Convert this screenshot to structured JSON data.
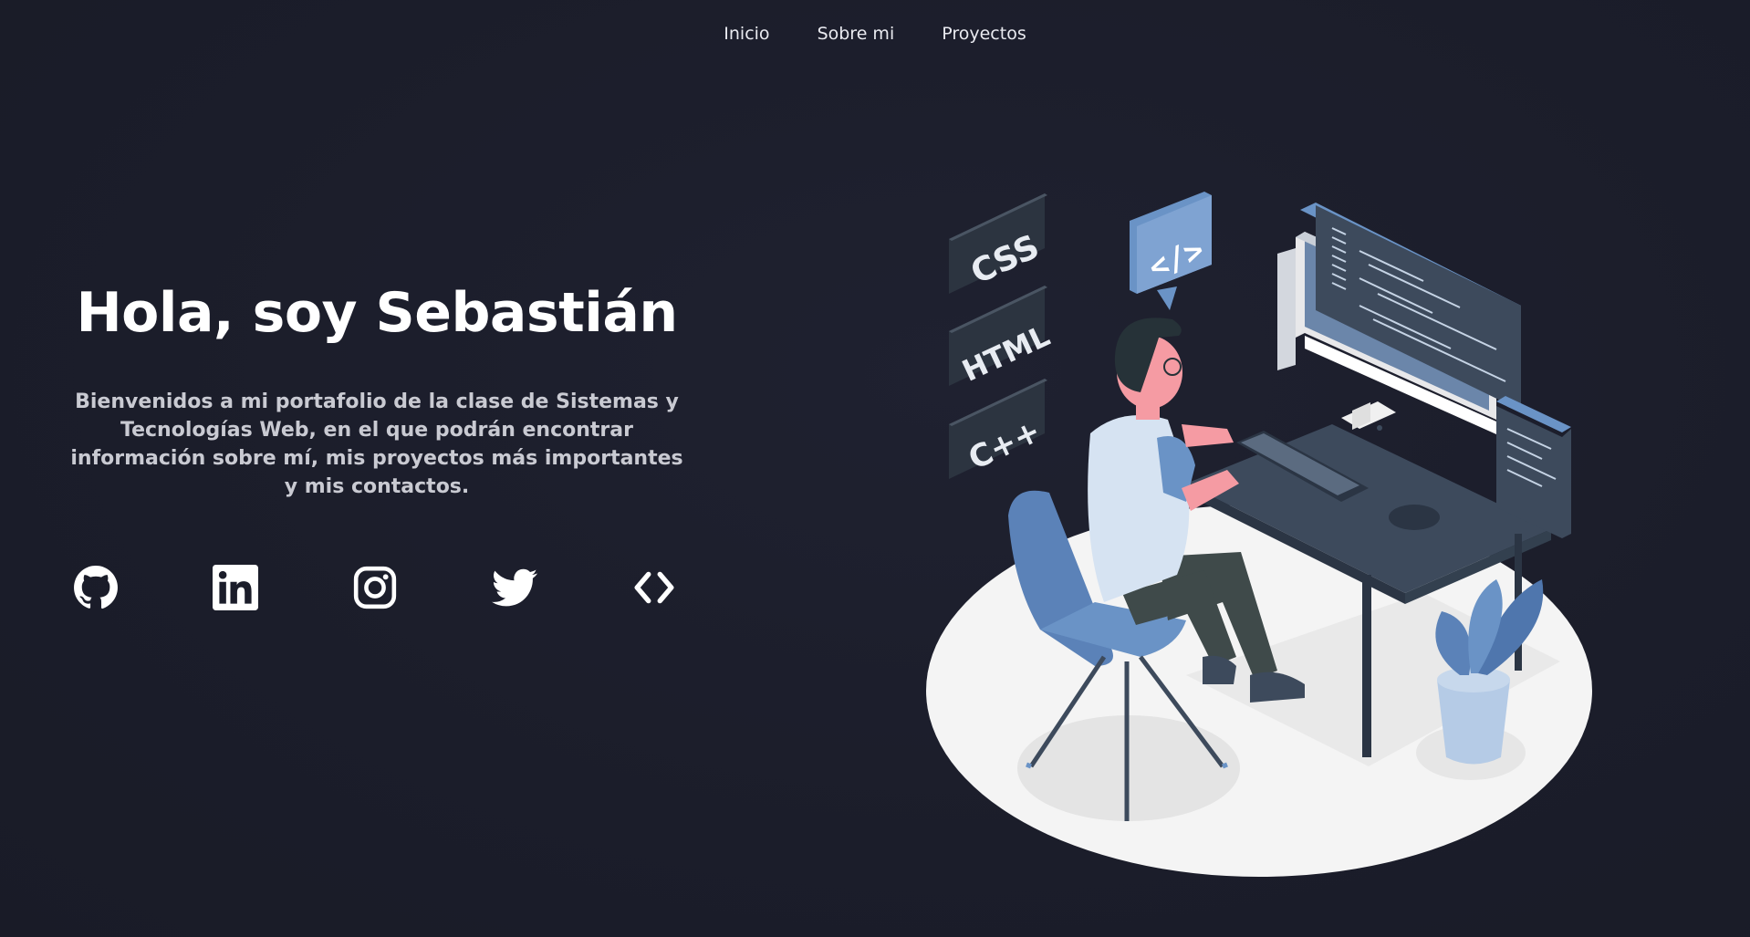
{
  "nav": {
    "items": [
      {
        "label": "Inicio"
      },
      {
        "label": "Sobre mi"
      },
      {
        "label": "Proyectos"
      }
    ]
  },
  "hero": {
    "title": "Hola, soy Sebastián",
    "description": "Bienvenidos a mi portafolio de la clase de Sistemas y Tecnologías Web, en el que podrán encontrar información sobre mí, mis proyectos más importantes y mis contactos."
  },
  "socials": [
    {
      "icon": "github-icon"
    },
    {
      "icon": "linkedin-icon"
    },
    {
      "icon": "instagram-icon"
    },
    {
      "icon": "twitter-icon"
    },
    {
      "icon": "code-icon"
    }
  ],
  "illustration": {
    "badges": [
      "CSS",
      "HTML",
      "C++"
    ],
    "bubble": "</>"
  },
  "colors": {
    "background": "#1c1e2b",
    "text": "#ffffff",
    "muted_text": "#c9cad2",
    "accent_blue": "#6a93c6",
    "dark_slate": "#3d4a5c",
    "platform": "#f4f4f4"
  }
}
